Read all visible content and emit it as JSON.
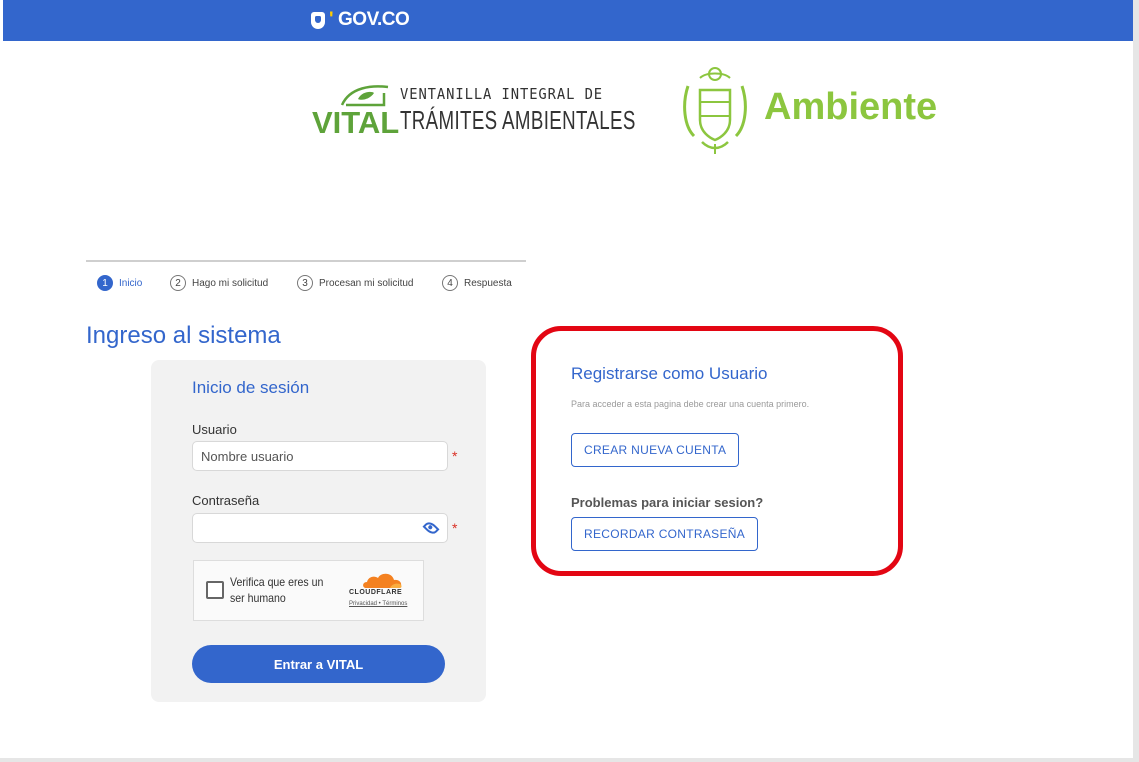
{
  "gov_bar": {
    "logo_text": "GOV.CO",
    "colors": {
      "bar": "#3366cc",
      "accent": "#ffcc00"
    }
  },
  "header": {
    "vital": {
      "word": "VITAL",
      "line1": "VENTANILLA INTEGRAL DE",
      "line2": "TRÁMITES AMBIENTALES",
      "color": "#5ea33a"
    },
    "ambiente": {
      "word": "Ambiente",
      "seal_icon": "colombia-coat-of-arms-icon",
      "color": "#8cc63f"
    }
  },
  "steps": [
    {
      "num": "1",
      "label": "Inicio",
      "active": true
    },
    {
      "num": "2",
      "label": "Hago mi solicitud",
      "active": false
    },
    {
      "num": "3",
      "label": "Procesan mi solicitud",
      "active": false
    },
    {
      "num": "4",
      "label": "Respuesta",
      "active": false
    }
  ],
  "page_title": "Ingreso al sistema",
  "login": {
    "title": "Inicio de sesión",
    "user_label": "Usuario",
    "user_placeholder": "Nombre usuario",
    "user_value": "",
    "password_label": "Contraseña",
    "password_value": "",
    "required_mark": "*",
    "captcha": {
      "text": "Verifica que eres un ser humano",
      "brand": "CLOUDFLARE",
      "links": "Privacidad • Términos"
    },
    "submit_label": "Entrar a VITAL"
  },
  "register": {
    "title": "Registrarse como Usuario",
    "subtitle": "Para acceder a esta pagina debe crear una cuenta primero.",
    "create_label": "CREAR NUEVA CUENTA",
    "problem_text": "Problemas para iniciar sesion?",
    "remember_label": "RECORDAR CONTRASEÑA",
    "highlight_color": "#e30613"
  }
}
